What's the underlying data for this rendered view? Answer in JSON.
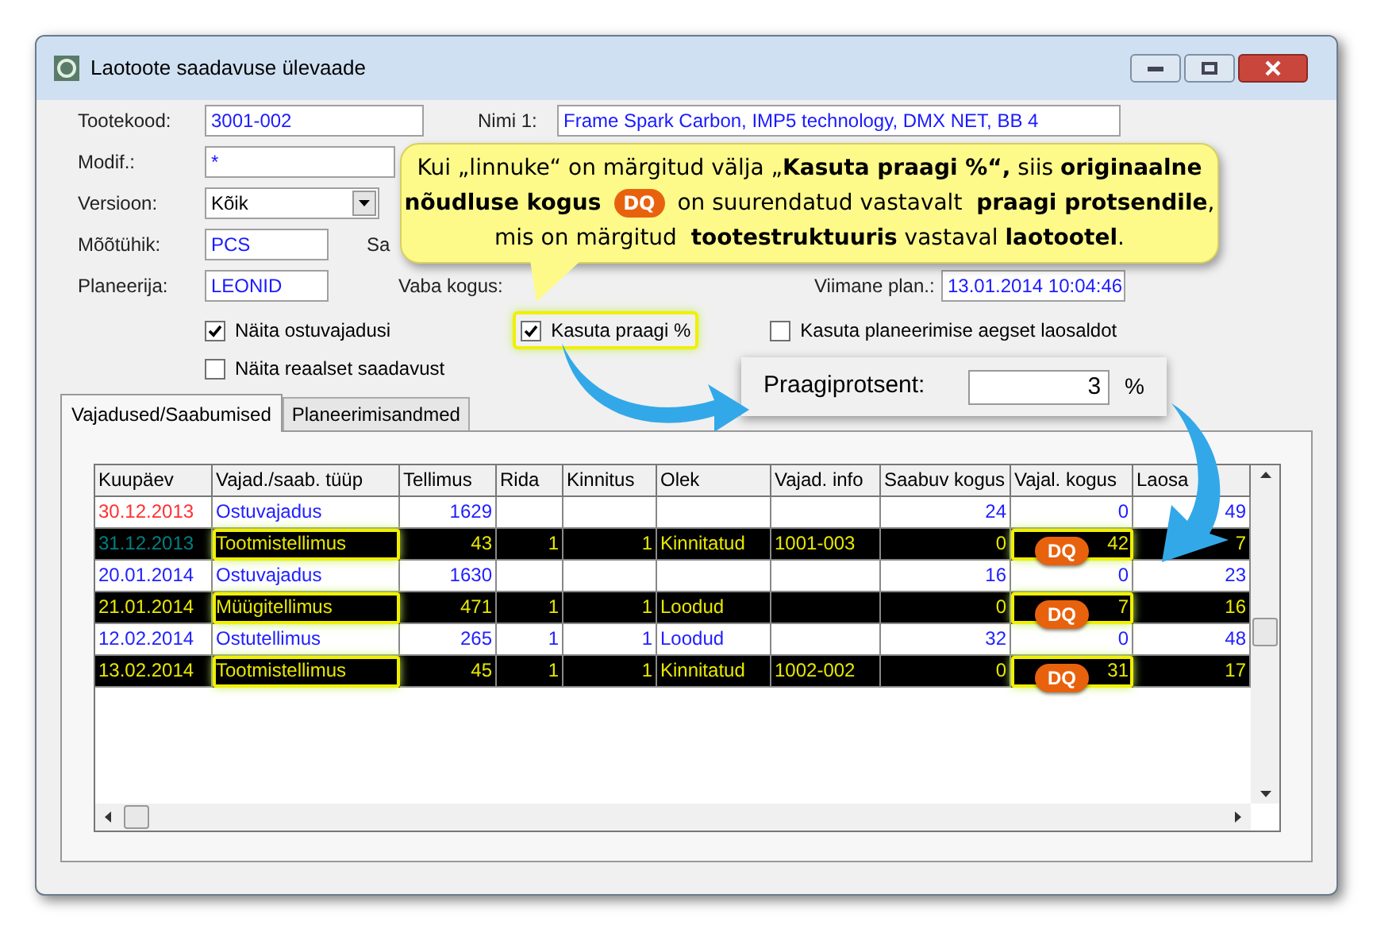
{
  "window": {
    "title": "Laotoote saadavuse ülevaade"
  },
  "form": {
    "tootekood": {
      "label": "Tootekood:",
      "value": "3001-002"
    },
    "nimi": {
      "label": "Nimi 1:",
      "value": "Frame Spark Carbon, IMP5 technology, DMX NET, BB 4"
    },
    "modif": {
      "label": "Modif.:",
      "value": "*"
    },
    "versioon": {
      "label": "Versioon:",
      "value": "Kõik"
    },
    "mootuhik": {
      "label": "Mõõtühik:",
      "value": "PCS"
    },
    "saabunud": {
      "label": "Sa"
    },
    "planeerija": {
      "label": "Planeerija:",
      "value": "LEONID"
    },
    "vaba": {
      "label": "Vaba kogus:"
    },
    "viimane": {
      "label": "Viimane plan.:",
      "value": "13.01.2014 10:04:46"
    }
  },
  "checkboxes": [
    {
      "label": "Näita ostuvajadusi",
      "checked": true,
      "highlighted": false
    },
    {
      "label": "Näita reaalset saadavust",
      "checked": false,
      "highlighted": false
    },
    {
      "label": "Kasuta praagi %",
      "checked": true,
      "highlighted": true
    },
    {
      "label": "Kasuta planeerimise aegset laosaldot",
      "checked": false,
      "highlighted": false
    }
  ],
  "tabs": [
    {
      "label": "Vajadused/Saabumised",
      "selected": true
    },
    {
      "label": "Planeerimisandmed",
      "selected": false
    }
  ],
  "table": {
    "columns": [
      "Kuupäev",
      "Vajad./saab. tüüp",
      "Tellimus",
      "Rida",
      "Kinnitus",
      "Olek",
      "Vajad. info",
      "Saabuv kogus",
      "Vajal. kogus",
      "Laosa"
    ],
    "rows": [
      {
        "cells": [
          "30.12.2013",
          "Ostuvajadus",
          "1629",
          "",
          "",
          "",
          "",
          "24",
          "0",
          "49"
        ],
        "color": "#ff3030",
        "highlighted": false,
        "badge": ""
      },
      {
        "cells": [
          "31.12.2013",
          "Tootmistellimus",
          "43",
          "1",
          "1",
          "Kinnitatud",
          "1001-003",
          "0",
          "42",
          "7"
        ],
        "color": "#008080",
        "highlighted": true,
        "badge": "DQ"
      },
      {
        "cells": [
          "20.01.2014",
          "Ostuvajadus",
          "1630",
          "",
          "",
          "",
          "",
          "16",
          "0",
          "23"
        ],
        "color": "#2020ff",
        "highlighted": false,
        "badge": ""
      },
      {
        "cells": [
          "21.01.2014",
          "Müügitellimus",
          "471",
          "1",
          "1",
          "Loodud",
          "",
          "0",
          "7",
          "16"
        ],
        "color": "#e8e800",
        "highlighted": true,
        "badge": "DQ"
      },
      {
        "cells": [
          "12.02.2014",
          "Ostutellimus",
          "265",
          "1",
          "1",
          "Loodud",
          "",
          "32",
          "0",
          "48"
        ],
        "color": "#2020ff",
        "highlighted": false,
        "badge": ""
      },
      {
        "cells": [
          "13.02.2014",
          "Tootmistellimus",
          "45",
          "1",
          "1",
          "Kinnitatud",
          "1002-002",
          "0",
          "31",
          "17"
        ],
        "color": "#e8e800",
        "highlighted": true,
        "badge": "DQ"
      }
    ]
  },
  "praagi": {
    "label": "Praagiprotsent:",
    "value": "3",
    "unit": "%"
  },
  "callout": {
    "line_1": "Kui „linnuke“ on märgitud välja „**Kasuta praagi %“,** siis **originaalne**",
    "line_2_before": "**nõudluse kogus**",
    "badge": "DQ",
    "line_2_after": "on suurendatud vastavalt  **praagi protsendile**,",
    "line_3": "mis on märgitud  **tootestruktuuris** vastaval **laotootel**."
  }
}
